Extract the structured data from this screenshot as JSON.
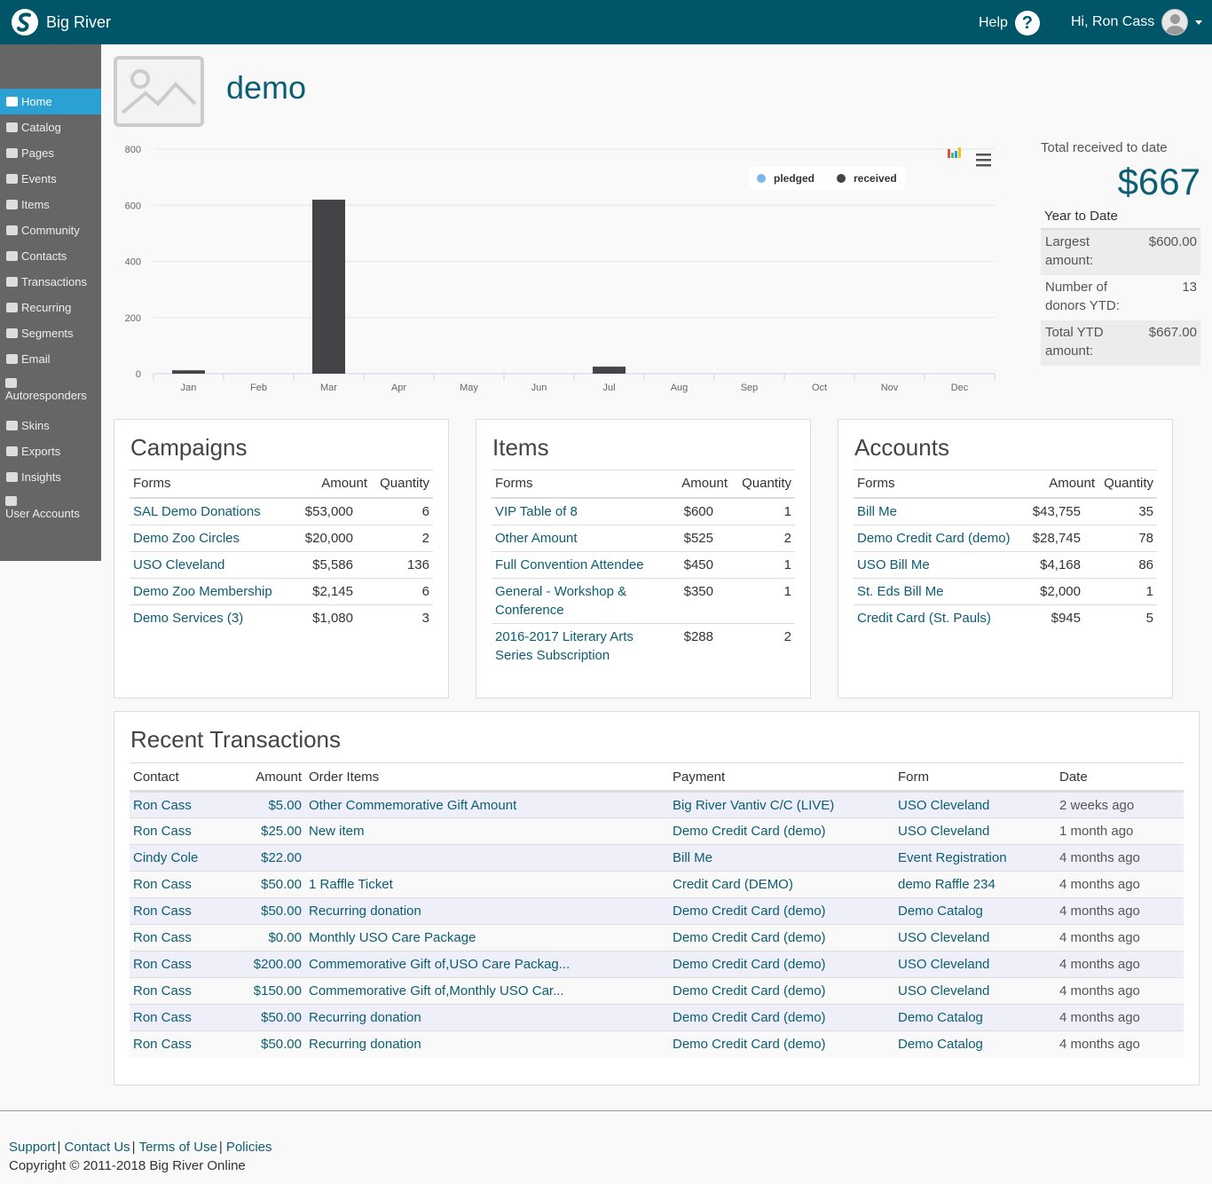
{
  "brand": {
    "name": "Big River"
  },
  "topbar": {
    "help_label": "Help",
    "user_greeting": "Hi, Ron Cass"
  },
  "sidebar": {
    "items": [
      {
        "label": "Home",
        "active": true
      },
      {
        "label": "Catalog"
      },
      {
        "label": "Pages"
      },
      {
        "label": "Events"
      },
      {
        "label": "Items"
      },
      {
        "label": "Community"
      },
      {
        "label": "Contacts"
      },
      {
        "label": "Transactions"
      },
      {
        "label": "Recurring"
      },
      {
        "label": "Segments"
      },
      {
        "label": "Email"
      },
      {
        "label": "Autoresponders"
      },
      {
        "label": "Skins"
      },
      {
        "label": "Exports"
      },
      {
        "label": "Insights"
      },
      {
        "label": "User Accounts"
      }
    ]
  },
  "page": {
    "title": "demo"
  },
  "chart_data": {
    "type": "bar",
    "categories": [
      "Jan",
      "Feb",
      "Mar",
      "Apr",
      "May",
      "Jun",
      "Jul",
      "Aug",
      "Sep",
      "Oct",
      "Nov",
      "Dec"
    ],
    "series": [
      {
        "name": "pledged",
        "values": [
          0,
          0,
          0,
          0,
          0,
          0,
          0,
          0,
          0,
          0,
          0,
          0
        ],
        "color": "#7cb5ec"
      },
      {
        "name": "received",
        "values": [
          12,
          0,
          620,
          0,
          0,
          0,
          25,
          0,
          0,
          0,
          0,
          0
        ],
        "color": "#434348"
      }
    ],
    "y_ticks": [
      0,
      200,
      400,
      600,
      800
    ],
    "ylim": [
      0,
      800
    ],
    "legend_position": "top-right",
    "grid": true
  },
  "summary": {
    "total_label": "Total received to date",
    "total_value": "$667",
    "ytd_label": "Year to Date",
    "rows": [
      {
        "label": "Largest amount:",
        "value": "$600.00"
      },
      {
        "label": "Number of donors YTD:",
        "value": "13"
      },
      {
        "label": "Total YTD amount:",
        "value": "$667.00"
      }
    ]
  },
  "campaigns": {
    "title": "Campaigns",
    "headers": [
      "Forms",
      "Amount",
      "Quantity"
    ],
    "rows": [
      [
        "SAL Demo Donations",
        "$53,000",
        "6"
      ],
      [
        "Demo Zoo Circles",
        "$20,000",
        "2"
      ],
      [
        "USO Cleveland",
        "$5,586",
        "136"
      ],
      [
        "Demo Zoo Membership",
        "$2,145",
        "6"
      ],
      [
        "Demo Services (3)",
        "$1,080",
        "3"
      ]
    ]
  },
  "items": {
    "title": "Items",
    "headers": [
      "Forms",
      "Amount",
      "Quantity"
    ],
    "rows": [
      [
        "VIP Table of 8",
        "$600",
        "1"
      ],
      [
        "Other Amount",
        "$525",
        "2"
      ],
      [
        "Full Convention Attendee",
        "$450",
        "1"
      ],
      [
        "General - Workshop & Conference",
        "$350",
        "1"
      ],
      [
        "2016-2017 Literary Arts Series Subscription",
        "$288",
        "2"
      ]
    ]
  },
  "accounts": {
    "title": "Accounts",
    "headers": [
      "Forms",
      "Amount",
      "Quantity"
    ],
    "rows": [
      [
        "Bill Me",
        "$43,755",
        "35"
      ],
      [
        "Demo Credit Card (demo)",
        "$28,745",
        "78"
      ],
      [
        "USO Bill Me",
        "$4,168",
        "86"
      ],
      [
        "St. Eds Bill Me",
        "$2,000",
        "1"
      ],
      [
        "Credit Card (St. Pauls)",
        "$945",
        "5"
      ]
    ]
  },
  "transactions": {
    "title": "Recent Transactions",
    "headers": [
      "Contact",
      "Amount",
      "Order Items",
      "Payment",
      "Form",
      "Date"
    ],
    "rows": [
      [
        "Ron Cass",
        "$5.00",
        "Other Commemorative Gift Amount",
        "Big River Vantiv C/C (LIVE)",
        "USO Cleveland",
        "2 weeks ago"
      ],
      [
        "Ron Cass",
        "$25.00",
        "New item",
        "Demo Credit Card (demo)",
        "USO Cleveland",
        "1 month ago"
      ],
      [
        "Cindy Cole",
        "$22.00",
        "",
        "Bill Me",
        "Event Registration",
        "4 months ago"
      ],
      [
        "Ron Cass",
        "$50.00",
        "1 Raffle Ticket",
        "Credit Card (DEMO)",
        "demo Raffle 234",
        "4 months ago"
      ],
      [
        "Ron Cass",
        "$50.00",
        "Recurring donation",
        "Demo Credit Card (demo)",
        "Demo Catalog",
        "4 months ago"
      ],
      [
        "Ron Cass",
        "$0.00",
        "Monthly USO Care Package",
        "Demo Credit Card (demo)",
        "USO Cleveland",
        "4 months ago"
      ],
      [
        "Ron Cass",
        "$200.00",
        "Commemorative Gift of,USO Care Packag...",
        "Demo Credit Card (demo)",
        "USO Cleveland",
        "4 months ago"
      ],
      [
        "Ron Cass",
        "$150.00",
        "Commemorative Gift of,Monthly USO Car...",
        "Demo Credit Card (demo)",
        "USO Cleveland",
        "4 months ago"
      ],
      [
        "Ron Cass",
        "$50.00",
        "Recurring donation",
        "Demo Credit Card (demo)",
        "Demo Catalog",
        "4 months ago"
      ],
      [
        "Ron Cass",
        "$50.00",
        "Recurring donation",
        "Demo Credit Card (demo)",
        "Demo Catalog",
        "4 months ago"
      ]
    ]
  },
  "footer": {
    "links": [
      "Support",
      "Contact Us",
      "Terms of Use",
      "Policies"
    ],
    "separator": "|",
    "copyright": "Copyright © 2011-2018 Big River Online"
  }
}
